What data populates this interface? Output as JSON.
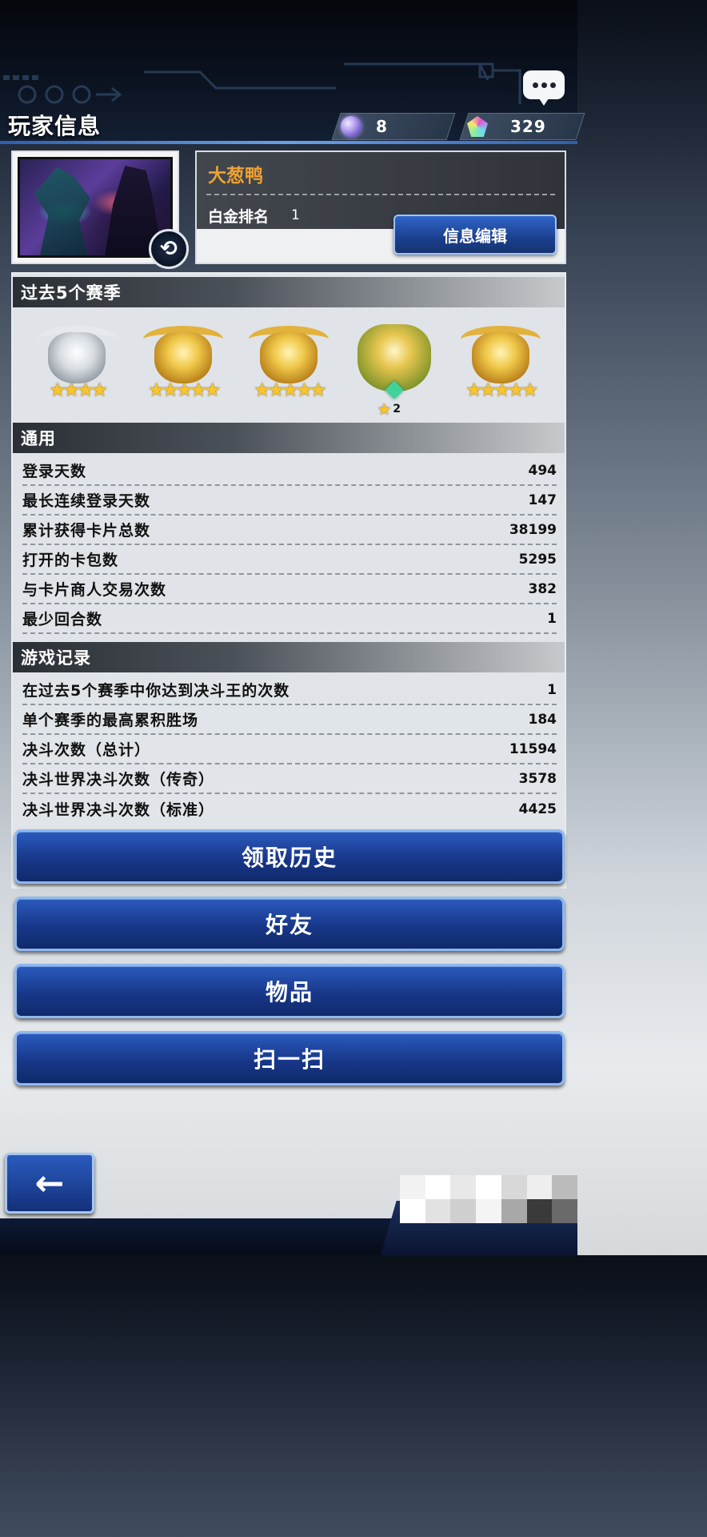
{
  "header": {
    "title": "玩家信息",
    "gems": "8",
    "crystals": "329"
  },
  "profile": {
    "name": "大葱鸭",
    "rank_label": "白金排名",
    "rank_value": "1",
    "edit_label": "信息编辑"
  },
  "seasons": {
    "title": "过去5个赛季",
    "badges": [
      {
        "tier": "silver",
        "stars": "★★★★"
      },
      {
        "tier": "gold",
        "stars": "★★★★★"
      },
      {
        "tier": "gold",
        "stars": "★★★★★"
      },
      {
        "tier": "platinum",
        "count": "2"
      },
      {
        "tier": "gold",
        "stars": "★★★★★"
      }
    ]
  },
  "general": {
    "title": "通用",
    "rows": [
      {
        "label": "登录天数",
        "value": "494"
      },
      {
        "label": "最长连续登录天数",
        "value": "147"
      },
      {
        "label": "累计获得卡片总数",
        "value": "38199"
      },
      {
        "label": "打开的卡包数",
        "value": "5295"
      },
      {
        "label": "与卡片商人交易次数",
        "value": "382"
      },
      {
        "label": "最少回合数",
        "value": "1"
      }
    ]
  },
  "records": {
    "title": "游戏记录",
    "rows": [
      {
        "label": "在过去5个赛季中你达到决斗王的次数",
        "value": "1"
      },
      {
        "label": "单个赛季的最高累积胜场",
        "value": "184"
      },
      {
        "label": "决斗次数（总计）",
        "value": "11594"
      },
      {
        "label": "决斗世界决斗次数（传奇）",
        "value": "3578"
      },
      {
        "label": "决斗世界决斗次数（标准）",
        "value": "4425"
      }
    ]
  },
  "buttons": {
    "history": "领取历史",
    "friends": "好友",
    "items": "物品",
    "scan": "扫一扫"
  },
  "icons": {
    "chat": "chat-bubble-icon",
    "gem": "gem-icon",
    "crystal": "crystal-icon",
    "refresh": "refresh-icon",
    "back": "back-arrow-icon"
  },
  "colors": {
    "player_name": "#f0a234",
    "button_blue": "#18378a",
    "accent_border": "#8fb8ee"
  }
}
